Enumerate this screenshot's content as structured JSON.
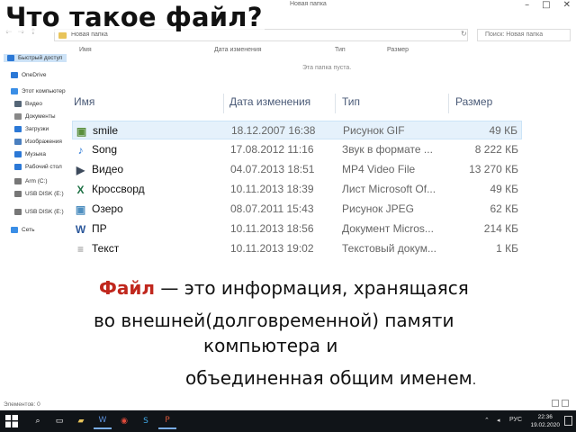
{
  "window": {
    "title": "Новая папка",
    "controls": [
      "–",
      "□",
      "✕"
    ]
  },
  "address_bar": {
    "path": "Новая папка",
    "nav": [
      "←",
      "→",
      "↑"
    ],
    "refresh": "↻",
    "search_placeholder": "Поиск: Новая папка"
  },
  "background_columns": [
    "Имя",
    "Дата изменения",
    "Тип",
    "Размер"
  ],
  "background_empty_text": "Эта папка пуста.",
  "nav_pane": [
    {
      "label": "Быстрый доступ",
      "icon": "star-icon",
      "color": "#2b78d6"
    },
    {
      "label": "OneDrive",
      "icon": "cloud-icon",
      "color": "#2b78d6"
    },
    {
      "label": "Этот компьютер",
      "icon": "computer-icon",
      "color": "#3a8ee6"
    },
    {
      "label": "Видео",
      "icon": "video-icon",
      "color": "#556677"
    },
    {
      "label": "Документы",
      "icon": "documents-icon",
      "color": "#888888"
    },
    {
      "label": "Загрузки",
      "icon": "downloads-icon",
      "color": "#2b78d6"
    },
    {
      "label": "Изображения",
      "icon": "pictures-icon",
      "color": "#4a7fbf"
    },
    {
      "label": "Музыка",
      "icon": "music-icon",
      "color": "#2b78d6"
    },
    {
      "label": "Рабочий стол",
      "icon": "desktop-icon",
      "color": "#2b78d6"
    },
    {
      "label": "Arm (C:)",
      "icon": "drive-icon",
      "color": "#777777"
    },
    {
      "label": "USB DISK (E:)",
      "icon": "usb-drive-icon",
      "color": "#777777"
    },
    {
      "label": "USB DISK (E:)",
      "icon": "usb-drive-icon",
      "color": "#777777"
    },
    {
      "label": "Сеть",
      "icon": "network-icon",
      "color": "#3a8ee6"
    }
  ],
  "slide_title": "Что такое файл?",
  "file_list": {
    "columns": {
      "name": "Имя",
      "date": "Дата изменения",
      "type": "Тип",
      "size": "Размер"
    },
    "rows": [
      {
        "name": "smile",
        "date": "18.12.2007 16:38",
        "type": "Рисунок GIF",
        "size": "49 КБ",
        "icon": "gif-image-icon",
        "color": "#5a8f3c"
      },
      {
        "name": "Song",
        "date": "17.08.2012 11:16",
        "type": "Звук в формате ...",
        "size": "8 222 КБ",
        "icon": "music-note-icon",
        "color": "#2b78d6"
      },
      {
        "name": "Видео",
        "date": "04.07.2013 18:51",
        "type": "MP4 Video File",
        "size": "13 270 КБ",
        "icon": "video-file-icon",
        "color": "#3d4a5c"
      },
      {
        "name": "Кроссворд",
        "date": "10.11.2013 18:39",
        "type": "Лист Microsoft Of...",
        "size": "49 КБ",
        "icon": "excel-file-icon",
        "color": "#1e7145"
      },
      {
        "name": "Озеро",
        "date": "08.07.2011 15:43",
        "type": "Рисунок JPEG",
        "size": "62 КБ",
        "icon": "jpeg-image-icon",
        "color": "#4f8fc0"
      },
      {
        "name": "ПР",
        "date": "10.11.2013 18:56",
        "type": "Документ Micros...",
        "size": "214 КБ",
        "icon": "word-file-icon",
        "color": "#2b579a"
      },
      {
        "name": "Текст",
        "date": "10.11.2013 19:02",
        "type": "Текстовый докум...",
        "size": "1 КБ",
        "icon": "text-file-icon",
        "color": "#8a8a8a"
      }
    ]
  },
  "definition": {
    "term": "Файл",
    "line1_rest": " — это информация, хранящаяся",
    "line2": "во внешней(долговременной) памяти",
    "line3": "компьютера и",
    "line4": "объединенная общим именем",
    "line4_end": "."
  },
  "status_bar": {
    "text": "Элементов: 0"
  },
  "taskbar": {
    "apps": [
      {
        "name": "taskbar-search",
        "glyph": "⌕"
      },
      {
        "name": "taskbar-task-view",
        "glyph": "▭"
      },
      {
        "name": "taskbar-explorer",
        "glyph": "▰"
      },
      {
        "name": "taskbar-word",
        "glyph": "W"
      },
      {
        "name": "taskbar-chrome",
        "glyph": "◉"
      },
      {
        "name": "taskbar-skype",
        "glyph": "S"
      },
      {
        "name": "taskbar-powerpoint",
        "glyph": "P"
      }
    ],
    "language": "РУС",
    "time": "22:36",
    "date": "19.02.2020"
  }
}
